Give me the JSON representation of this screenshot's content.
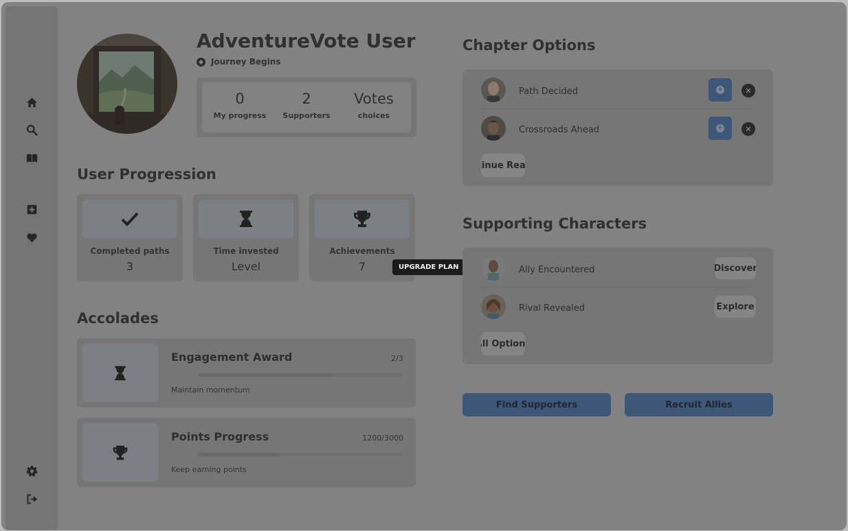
{
  "sidebar": {
    "items": [
      {
        "icon": "home-icon"
      },
      {
        "icon": "search-icon"
      },
      {
        "icon": "book-icon"
      },
      {
        "icon": "plus-square-icon"
      },
      {
        "icon": "heart-icon"
      },
      {
        "icon": "gear-icon"
      },
      {
        "icon": "logout-icon"
      }
    ]
  },
  "profile": {
    "name": "AdventureVote User",
    "tagline": "Journey Begins",
    "stats": [
      {
        "value": "0",
        "label": "My progress"
      },
      {
        "value": "2",
        "label": "Supporters"
      },
      {
        "value": "Votes",
        "label": "choices"
      }
    ]
  },
  "progression": {
    "title": "User Progression",
    "cards": [
      {
        "icon": "check-icon",
        "label": "Completed paths",
        "value": "3"
      },
      {
        "icon": "hourglass-icon",
        "label": "Time invested",
        "value": "Level"
      },
      {
        "icon": "trophy-icon",
        "label": "Achievements",
        "value": "7"
      }
    ]
  },
  "tooltip": "UPGRADE PLAN",
  "accolades": {
    "title": "Accolades",
    "items": [
      {
        "icon": "hourglass-icon",
        "title": "Engagement Award",
        "count": "2/3",
        "desc": "Maintain momentum",
        "progress": 0.67
      },
      {
        "icon": "trophy-icon",
        "title": "Points Progress",
        "count": "1200/3000",
        "desc": "Keep earning points",
        "progress": 0.4
      }
    ]
  },
  "chapter_options": {
    "title": "Chapter Options",
    "items": [
      {
        "name": "Path Decided"
      },
      {
        "name": "Crossroads Ahead"
      }
    ],
    "chip": "Continue Reading"
  },
  "supporting": {
    "title": "Supporting Characters",
    "items": [
      {
        "name": "Ally Encountered",
        "action": "Discover"
      },
      {
        "name": "Rival Revealed",
        "action": "Explore"
      }
    ],
    "chip": "All Options"
  },
  "actions": {
    "find": "Find Supporters",
    "recruit": "Recruit Allies"
  },
  "colors": {
    "accent": "#3e5678",
    "panel": "#767676",
    "overlay": "#828282"
  }
}
